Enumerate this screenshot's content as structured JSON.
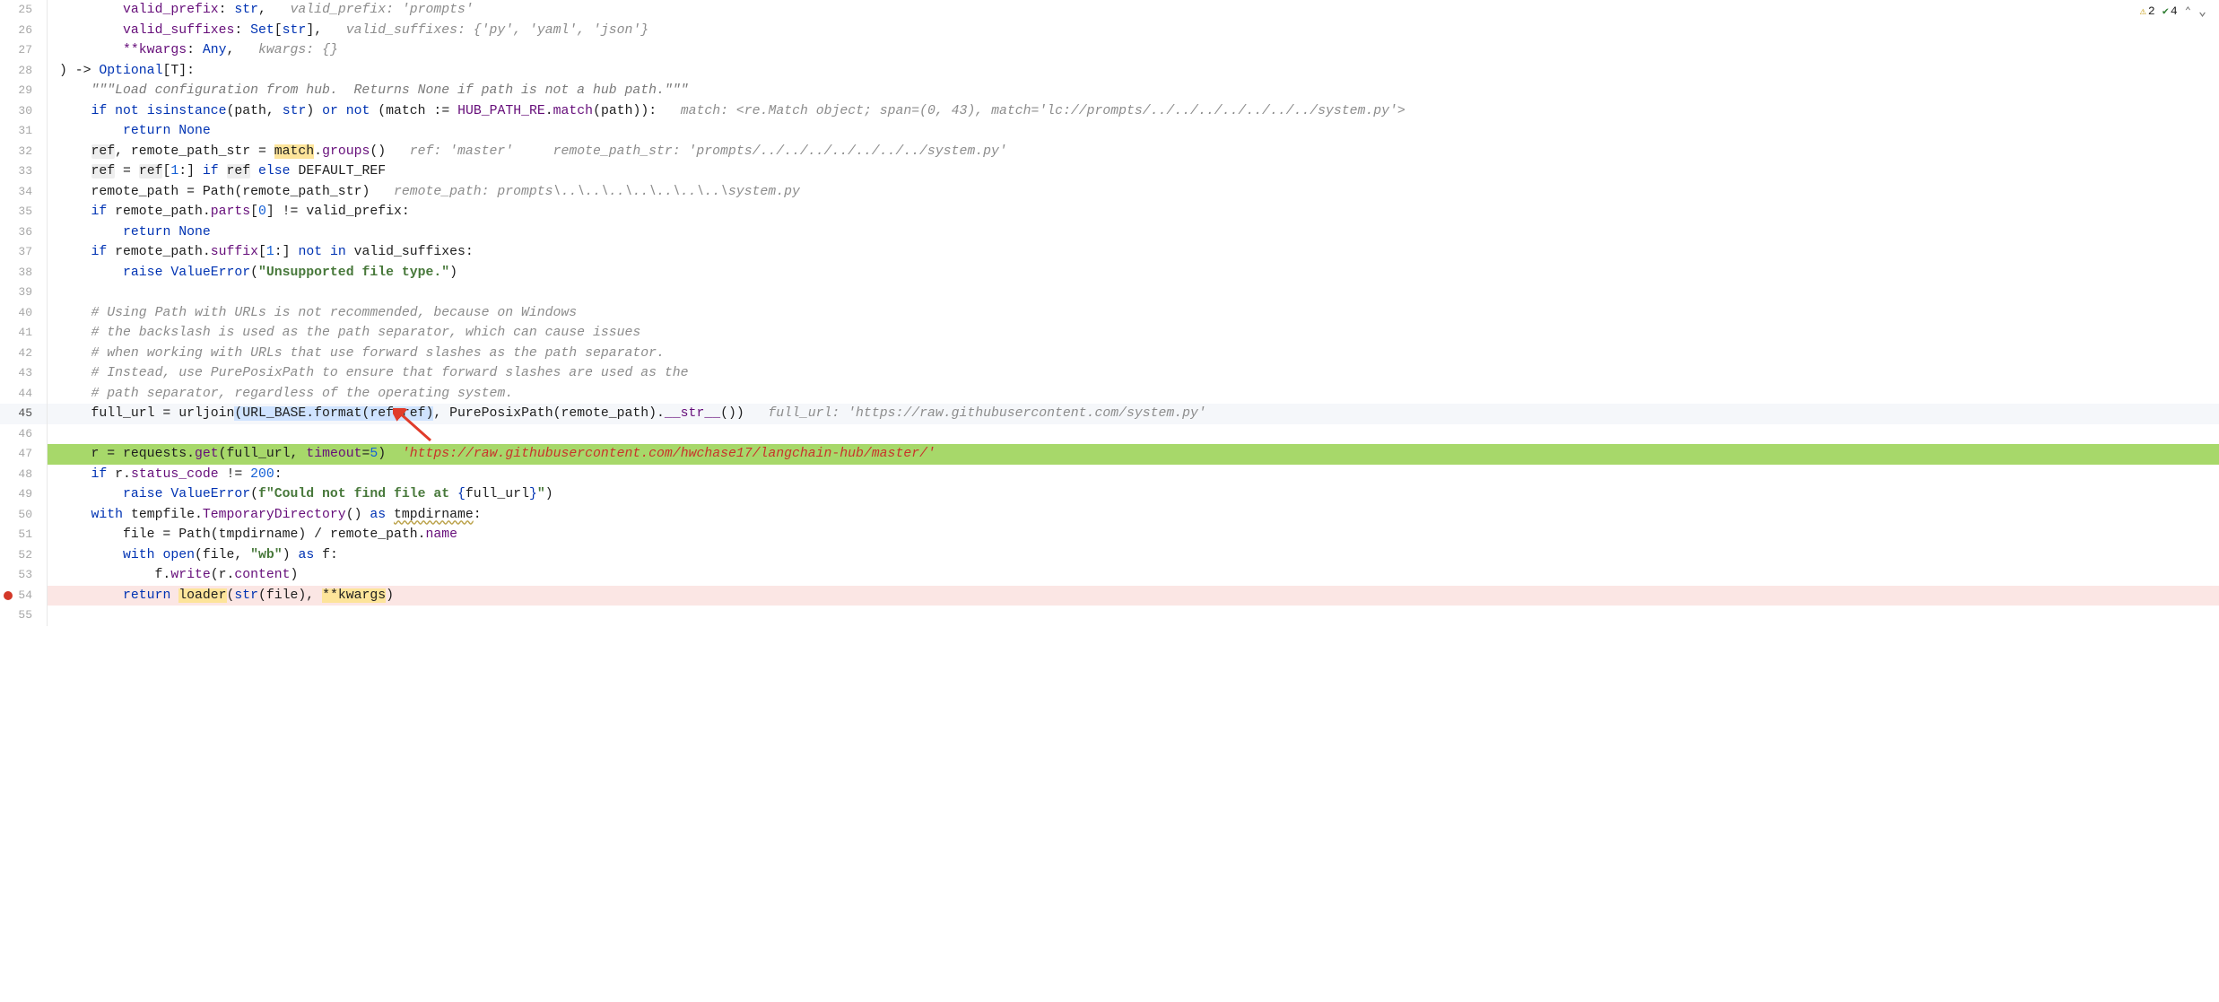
{
  "toolbar": {
    "warn_count": "2",
    "ok_count": "4"
  },
  "gutter_start": 25,
  "current_line": 45,
  "lines": [
    {
      "n": 25,
      "segs": [
        {
          "t": "        ",
          "c": ""
        },
        {
          "t": "valid_prefix",
          "c": "mg"
        },
        {
          "t": ": ",
          "c": ""
        },
        {
          "t": "str",
          "c": "kw2"
        },
        {
          "t": ",   ",
          "c": ""
        },
        {
          "t": "valid_prefix: 'prompts'",
          "c": "cm"
        }
      ]
    },
    {
      "n": 26,
      "segs": [
        {
          "t": "        ",
          "c": ""
        },
        {
          "t": "valid_suffixes",
          "c": "mg"
        },
        {
          "t": ": ",
          "c": ""
        },
        {
          "t": "Set",
          "c": "kw2"
        },
        {
          "t": "[",
          "c": ""
        },
        {
          "t": "str",
          "c": "kw2"
        },
        {
          "t": "],   ",
          "c": ""
        },
        {
          "t": "valid_suffixes: {'py', 'yaml', 'json'}",
          "c": "cm"
        }
      ]
    },
    {
      "n": 27,
      "segs": [
        {
          "t": "        ",
          "c": ""
        },
        {
          "t": "**kwargs",
          "c": "mg"
        },
        {
          "t": ": ",
          "c": ""
        },
        {
          "t": "Any",
          "c": "kw2"
        },
        {
          "t": ",   ",
          "c": ""
        },
        {
          "t": "kwargs: {}",
          "c": "cm"
        }
      ]
    },
    {
      "n": 28,
      "segs": [
        {
          "t": ") -> ",
          "c": ""
        },
        {
          "t": "Optional",
          "c": "kw2"
        },
        {
          "t": "[",
          "c": ""
        },
        {
          "t": "T",
          "c": "id"
        },
        {
          "t": "]:",
          "c": ""
        }
      ]
    },
    {
      "n": 29,
      "segs": [
        {
          "t": "    ",
          "c": ""
        },
        {
          "t": "\"\"\"Load configuration from hub.  Returns None if path is not a hub path.\"\"\"",
          "c": "doc"
        }
      ]
    },
    {
      "n": 30,
      "segs": [
        {
          "t": "    ",
          "c": ""
        },
        {
          "t": "if not ",
          "c": "kw2"
        },
        {
          "t": "isinstance",
          "c": "kw2"
        },
        {
          "t": "(",
          "c": ""
        },
        {
          "t": "path",
          "c": "id"
        },
        {
          "t": ", ",
          "c": ""
        },
        {
          "t": "str",
          "c": "kw2"
        },
        {
          "t": ") ",
          "c": ""
        },
        {
          "t": "or not ",
          "c": "kw2"
        },
        {
          "t": "(",
          "c": ""
        },
        {
          "t": "match := ",
          "c": ""
        },
        {
          "t": "HUB_PATH_RE",
          "c": "mg"
        },
        {
          "t": ".",
          "c": ""
        },
        {
          "t": "match",
          "c": "mg"
        },
        {
          "t": "(",
          "c": ""
        },
        {
          "t": "path",
          "c": "id"
        },
        {
          "t": ")):   ",
          "c": ""
        },
        {
          "t": "match: <re.Match object; span=(0, 43), match='lc://prompts/../../../../../../../system.py'>",
          "c": "cm"
        }
      ]
    },
    {
      "n": 31,
      "segs": [
        {
          "t": "        ",
          "c": ""
        },
        {
          "t": "return ",
          "c": "kw2"
        },
        {
          "t": "None",
          "c": "kw2"
        }
      ]
    },
    {
      "n": 32,
      "segs": [
        {
          "t": "    ",
          "c": ""
        },
        {
          "t": "ref",
          "c": "boxed"
        },
        {
          "t": ", remote_path_str = ",
          "c": ""
        },
        {
          "t": "match",
          "c": "hlw"
        },
        {
          "t": ".",
          "c": ""
        },
        {
          "t": "groups",
          "c": "mg"
        },
        {
          "t": "()   ",
          "c": ""
        },
        {
          "t": "ref: 'master'     remote_path_str: 'prompts/../../../../../../../system.py'",
          "c": "cm"
        }
      ]
    },
    {
      "n": 33,
      "segs": [
        {
          "t": "    ",
          "c": ""
        },
        {
          "t": "ref",
          "c": "boxed"
        },
        {
          "t": " = ",
          "c": ""
        },
        {
          "t": "ref",
          "c": "boxed"
        },
        {
          "t": "[",
          "c": ""
        },
        {
          "t": "1",
          "c": "num"
        },
        {
          "t": ":] ",
          "c": ""
        },
        {
          "t": "if ",
          "c": "kw2"
        },
        {
          "t": "ref",
          "c": "boxed"
        },
        {
          "t": " ",
          "c": ""
        },
        {
          "t": "else ",
          "c": "kw2"
        },
        {
          "t": "DEFAULT_REF",
          "c": "id"
        }
      ]
    },
    {
      "n": 34,
      "segs": [
        {
          "t": "    remote_path = ",
          "c": ""
        },
        {
          "t": "Path",
          "c": "id"
        },
        {
          "t": "(remote_path_str)   ",
          "c": ""
        },
        {
          "t": "remote_path: prompts\\..\\..\\..\\..\\..\\..\\..\\system.py",
          "c": "cm"
        }
      ]
    },
    {
      "n": 35,
      "segs": [
        {
          "t": "    ",
          "c": ""
        },
        {
          "t": "if ",
          "c": "kw2"
        },
        {
          "t": "remote_path.",
          "c": ""
        },
        {
          "t": "parts",
          "c": "mg"
        },
        {
          "t": "[",
          "c": ""
        },
        {
          "t": "0",
          "c": "num"
        },
        {
          "t": "] != valid_prefix:",
          "c": ""
        }
      ]
    },
    {
      "n": 36,
      "segs": [
        {
          "t": "        ",
          "c": ""
        },
        {
          "t": "return ",
          "c": "kw2"
        },
        {
          "t": "None",
          "c": "kw2"
        }
      ]
    },
    {
      "n": 37,
      "segs": [
        {
          "t": "    ",
          "c": ""
        },
        {
          "t": "if ",
          "c": "kw2"
        },
        {
          "t": "remote_path.",
          "c": ""
        },
        {
          "t": "suffix",
          "c": "mg"
        },
        {
          "t": "[",
          "c": ""
        },
        {
          "t": "1",
          "c": "num"
        },
        {
          "t": ":] ",
          "c": ""
        },
        {
          "t": "not in ",
          "c": "kw2"
        },
        {
          "t": "valid_suffixes:",
          "c": ""
        }
      ]
    },
    {
      "n": 38,
      "segs": [
        {
          "t": "        ",
          "c": ""
        },
        {
          "t": "raise ",
          "c": "kw2"
        },
        {
          "t": "ValueError",
          "c": "kw2"
        },
        {
          "t": "(",
          "c": ""
        },
        {
          "t": "\"Unsupported file type.\"",
          "c": "str"
        },
        {
          "t": ")",
          "c": ""
        }
      ]
    },
    {
      "n": 39,
      "segs": []
    },
    {
      "n": 40,
      "segs": [
        {
          "t": "    ",
          "c": ""
        },
        {
          "t": "# Using Path with URLs is not recommended, because on Windows",
          "c": "cm"
        }
      ]
    },
    {
      "n": 41,
      "segs": [
        {
          "t": "    ",
          "c": ""
        },
        {
          "t": "# the backslash is used as the path separator, which can cause issues",
          "c": "cm"
        }
      ]
    },
    {
      "n": 42,
      "segs": [
        {
          "t": "    ",
          "c": ""
        },
        {
          "t": "# when working with URLs that use forward slashes as the path separator.",
          "c": "cm"
        }
      ]
    },
    {
      "n": 43,
      "segs": [
        {
          "t": "    ",
          "c": ""
        },
        {
          "t": "# Instead, use PurePosixPath to ensure that forward slashes are used as the",
          "c": "cm"
        }
      ]
    },
    {
      "n": 44,
      "segs": [
        {
          "t": "    ",
          "c": ""
        },
        {
          "t": "# path separator, regardless of the operating system.",
          "c": "cm"
        }
      ]
    },
    {
      "n": 45,
      "active": true,
      "segs": [
        {
          "t": "    full_url = ",
          "c": ""
        },
        {
          "t": "urljoin",
          "c": "id"
        },
        {
          "t": "(",
          "c": "sel"
        },
        {
          "t": "URL_BASE.format(ref=ref)",
          "c": "sel"
        },
        {
          "t": ", ",
          "c": ""
        },
        {
          "t": "PurePosixPath",
          "c": "id"
        },
        {
          "t": "(remote_path).",
          "c": ""
        },
        {
          "t": "__str__",
          "c": "mg"
        },
        {
          "t": "())   ",
          "c": ""
        },
        {
          "t": "full_url: 'https://raw.githubusercontent.com/system.py'",
          "c": "cm"
        }
      ]
    },
    {
      "n": 46,
      "segs": []
    },
    {
      "n": 47,
      "hl": "green",
      "segs": [
        {
          "t": "    r = ",
          "c": ""
        },
        {
          "t": "requests",
          "c": "id"
        },
        {
          "t": ".",
          "c": ""
        },
        {
          "t": "get",
          "c": "mg"
        },
        {
          "t": "(full_url, ",
          "c": ""
        },
        {
          "t": "timeout",
          "c": "mg"
        },
        {
          "t": "=",
          "c": ""
        },
        {
          "t": "5",
          "c": "num"
        },
        {
          "t": ")  ",
          "c": ""
        },
        {
          "t": "'https://raw.githubusercontent.com/hwchase17/langchain-hub/master/'",
          "c": "cm-red"
        }
      ]
    },
    {
      "n": 48,
      "segs": [
        {
          "t": "    ",
          "c": ""
        },
        {
          "t": "if ",
          "c": "kw2"
        },
        {
          "t": "r.",
          "c": ""
        },
        {
          "t": "status_code",
          "c": "mg"
        },
        {
          "t": " != ",
          "c": ""
        },
        {
          "t": "200",
          "c": "num"
        },
        {
          "t": ":",
          "c": ""
        }
      ]
    },
    {
      "n": 49,
      "segs": [
        {
          "t": "        ",
          "c": ""
        },
        {
          "t": "raise ",
          "c": "kw2"
        },
        {
          "t": "ValueError",
          "c": "kw2"
        },
        {
          "t": "(",
          "c": ""
        },
        {
          "t": "f\"Could not find file at ",
          "c": "str"
        },
        {
          "t": "{",
          "c": "kw2"
        },
        {
          "t": "full_url",
          "c": "id"
        },
        {
          "t": "}",
          "c": "kw2"
        },
        {
          "t": "\"",
          "c": "str"
        },
        {
          "t": ")",
          "c": ""
        }
      ]
    },
    {
      "n": 50,
      "segs": [
        {
          "t": "    ",
          "c": ""
        },
        {
          "t": "with ",
          "c": "kw2"
        },
        {
          "t": "tempfile.",
          "c": ""
        },
        {
          "t": "TemporaryDirectory",
          "c": "mg"
        },
        {
          "t": "() ",
          "c": ""
        },
        {
          "t": "as ",
          "c": "kw2"
        },
        {
          "t": "tmpdirname",
          "c": "wavy"
        },
        {
          "t": ":",
          "c": ""
        }
      ]
    },
    {
      "n": 51,
      "segs": [
        {
          "t": "        file = ",
          "c": ""
        },
        {
          "t": "Path",
          "c": "id"
        },
        {
          "t": "(",
          "c": ""
        },
        {
          "t": "tmpdirname",
          "c": "id"
        },
        {
          "t": ") / remote_path.",
          "c": ""
        },
        {
          "t": "name",
          "c": "mg"
        }
      ]
    },
    {
      "n": 52,
      "segs": [
        {
          "t": "        ",
          "c": ""
        },
        {
          "t": "with ",
          "c": "kw2"
        },
        {
          "t": "open",
          "c": "kw2"
        },
        {
          "t": "(file, ",
          "c": ""
        },
        {
          "t": "\"wb\"",
          "c": "str"
        },
        {
          "t": ") ",
          "c": ""
        },
        {
          "t": "as ",
          "c": "kw2"
        },
        {
          "t": "f:",
          "c": ""
        }
      ]
    },
    {
      "n": 53,
      "segs": [
        {
          "t": "            f.",
          "c": ""
        },
        {
          "t": "write",
          "c": "mg"
        },
        {
          "t": "(r.",
          "c": ""
        },
        {
          "t": "content",
          "c": "mg"
        },
        {
          "t": ")",
          "c": ""
        }
      ]
    },
    {
      "n": 54,
      "hl": "red",
      "bp": true,
      "segs": [
        {
          "t": "        ",
          "c": ""
        },
        {
          "t": "return ",
          "c": "kw2"
        },
        {
          "t": "loader",
          "c": "hlw"
        },
        {
          "t": "(",
          "c": ""
        },
        {
          "t": "str",
          "c": "kw2"
        },
        {
          "t": "(file), ",
          "c": ""
        },
        {
          "t": "**kwargs",
          "c": "hlw"
        },
        {
          "t": ")",
          "c": ""
        }
      ]
    },
    {
      "n": 55,
      "segs": []
    }
  ],
  "arrow": {
    "points_at_token": "ref=ref on line 45"
  }
}
